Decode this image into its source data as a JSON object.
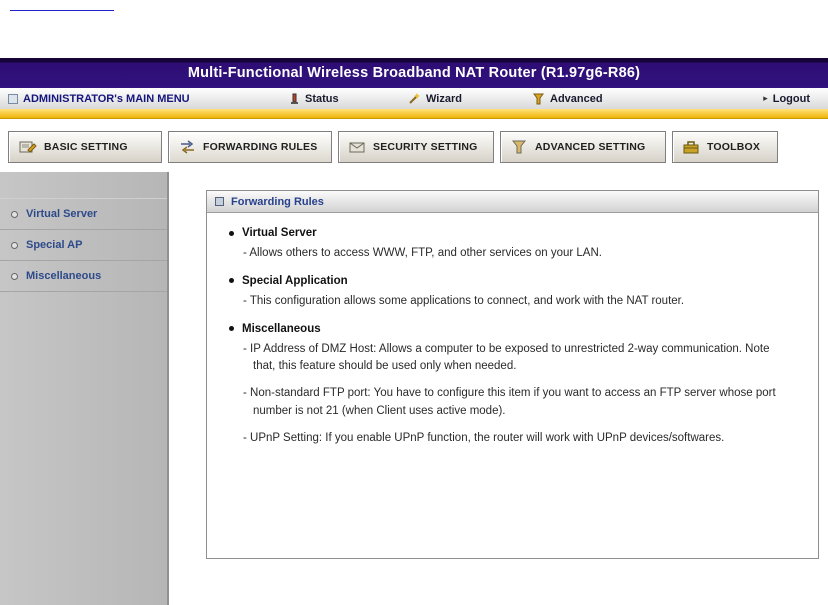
{
  "header": {
    "title": "Multi-Functional Wireless Broadband NAT Router (R1.97g6-R86)"
  },
  "menu": {
    "admin_label": "ADMINISTRATOR's MAIN MENU",
    "items": [
      {
        "label": "Status"
      },
      {
        "label": "Wizard"
      },
      {
        "label": "Advanced"
      }
    ],
    "logout_label": "Logout"
  },
  "tabs": [
    {
      "label": "BASIC SETTING",
      "active": false
    },
    {
      "label": "FORWARDING RULES",
      "active": true
    },
    {
      "label": "SECURITY SETTING",
      "active": false
    },
    {
      "label": "ADVANCED SETTING",
      "active": false
    },
    {
      "label": "TOOLBOX",
      "active": false
    }
  ],
  "sidebar": {
    "items": [
      {
        "label": "Virtual Server"
      },
      {
        "label": "Special AP"
      },
      {
        "label": "Miscellaneous"
      }
    ]
  },
  "content": {
    "panel_title": "Forwarding Rules",
    "sections": [
      {
        "heading": "Virtual Server",
        "lines": [
          "- Allows others to access WWW, FTP, and other services on your LAN."
        ]
      },
      {
        "heading": "Special Application",
        "lines": [
          "- This configuration allows some applications to connect, and work with the NAT router."
        ]
      },
      {
        "heading": "Miscellaneous",
        "lines": [
          "- IP Address of DMZ Host: Allows a computer to be exposed to unrestricted 2-way communication. Note that, this feature should be used only when needed.",
          "- Non-standard FTP port: You have to configure this item if you want to access an FTP server whose port number is not 21 (when Client uses active mode).",
          "- UPnP Setting: If you enable UPnP function, the router will work with UPnP devices/softwares."
        ]
      }
    ]
  },
  "colors": {
    "header_bg": "#2e0d74",
    "accent_yellow": "#efb608",
    "sidebar_bg": "#bdbdbd",
    "link_blue": "#27418c"
  }
}
